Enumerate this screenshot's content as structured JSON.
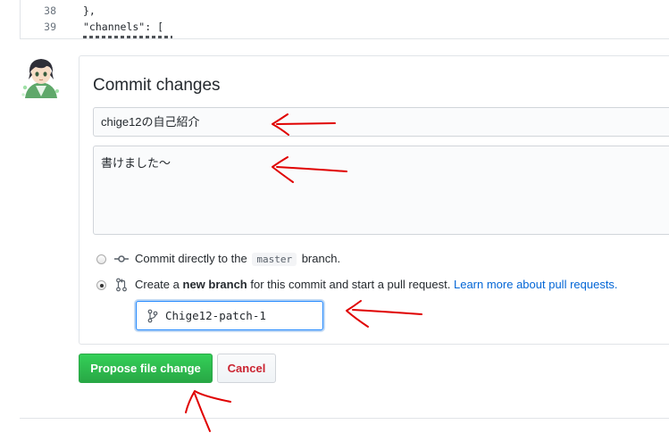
{
  "editor": {
    "lines": [
      {
        "num": "38",
        "code": "},"
      },
      {
        "num": "39",
        "code": "\"channels\": ["
      }
    ]
  },
  "commit": {
    "title": "Commit changes",
    "summary_value": "chige12の自己紹介",
    "description_value": "書けました～",
    "option_direct": {
      "prefix": "Commit directly to the",
      "branch": "master",
      "suffix": "branch."
    },
    "option_new_branch": {
      "prefix": "Create a",
      "bold": "new branch",
      "suffix": "for this commit and start a pull request.",
      "link": "Learn more about pull requests."
    },
    "branch_name": "Chige12-patch-1"
  },
  "actions": {
    "propose": "Propose file change",
    "cancel": "Cancel"
  },
  "colors": {
    "primary": "#28a745",
    "cancel_text": "#cb2431",
    "link": "#0366d6",
    "annotation": "#e00000"
  },
  "icons": {
    "commit": "git-commit-icon",
    "pull_request": "git-pull-request-icon",
    "branch": "git-branch-icon"
  }
}
